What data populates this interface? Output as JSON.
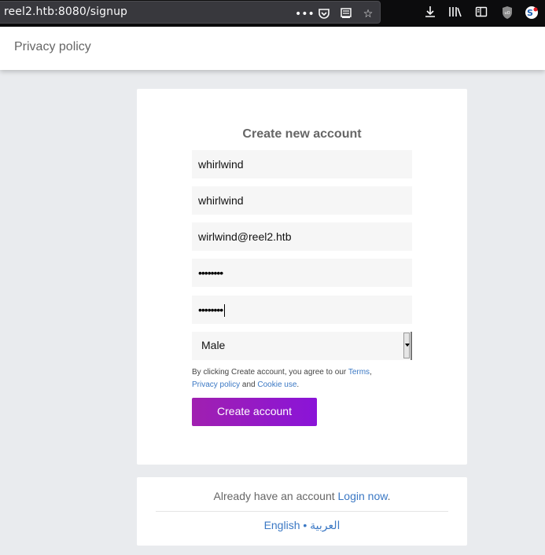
{
  "browser": {
    "url": "reel2.htb:8080/signup",
    "icons": [
      "more-icon",
      "pocket-icon",
      "reader-icon",
      "star-icon",
      "download-icon",
      "library-icon",
      "sidebar-icon",
      "ublock-icon",
      "extension-icon"
    ]
  },
  "header": {
    "privacy_link": "Privacy policy"
  },
  "signup": {
    "title": "Create new account",
    "fields": {
      "first_name": "whirlwind",
      "last_name": "whirlwind",
      "email": "wirlwind@reel2.htb",
      "password": "••••••••",
      "confirm_password": "••••••••"
    },
    "gender": {
      "selected": "Male"
    },
    "terms": {
      "prefix": "By clicking Create account, you agree to our",
      "terms_link": "Terms",
      "comma": ",",
      "privacy_link": "Privacy policy",
      "and": "and",
      "cookie_link": "Cookie use",
      "period": "."
    },
    "create_button": "Create account"
  },
  "footer": {
    "already_text": "Already have an account",
    "login_link": "Login now",
    "period": ".",
    "lang_english": "English",
    "lang_separator": "•",
    "lang_arabic": "العربية"
  },
  "colors": {
    "accent_start": "#a020b0",
    "accent_end": "#8a14d8",
    "link": "#3b78c4",
    "background": "#e9ebee"
  }
}
